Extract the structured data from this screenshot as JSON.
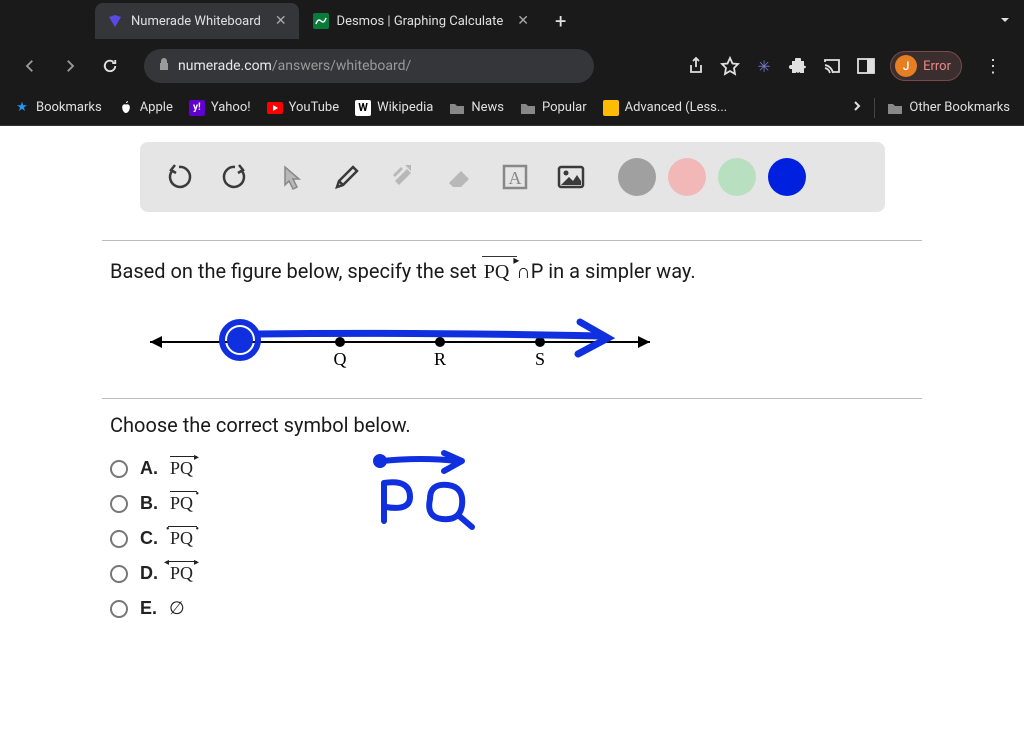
{
  "tabs": [
    {
      "title": "Numerade Whiteboard",
      "active": true
    },
    {
      "title": "Desmos | Graphing Calculate",
      "active": false
    }
  ],
  "url_domain": "numerade.com",
  "url_path": "/answers/whiteboard/",
  "profile": {
    "initial": "J",
    "status": "Error"
  },
  "bookmarks": {
    "items": [
      "Bookmarks",
      "Apple",
      "Yahoo!",
      "YouTube",
      "Wikipedia",
      "News",
      "Popular",
      "Advanced (Less..."
    ],
    "other": "Other Bookmarks"
  },
  "whiteboard": {
    "colors": [
      "#a0a0a0",
      "#f2b8b8",
      "#b8e0c0",
      "#0020e0"
    ]
  },
  "question": {
    "pre": "Based on the figure below, specify the set ",
    "set_label": "PQ",
    "mid": " ∩P in a simpler way.",
    "figure_points": [
      "Q",
      "R",
      "S"
    ]
  },
  "prompt": "Choose the correct symbol below.",
  "options": [
    {
      "letter": "A.",
      "symbol": "PQ",
      "bar": "right-arrow"
    },
    {
      "letter": "B.",
      "symbol": "PQ",
      "bar": "line-right"
    },
    {
      "letter": "C.",
      "symbol": "PQ",
      "bar": "line-both"
    },
    {
      "letter": "D.",
      "symbol": "PQ",
      "bar": "both-arrow"
    },
    {
      "letter": "E.",
      "symbol": "∅",
      "bar": "none"
    }
  ],
  "handwriting_label": "PQ"
}
